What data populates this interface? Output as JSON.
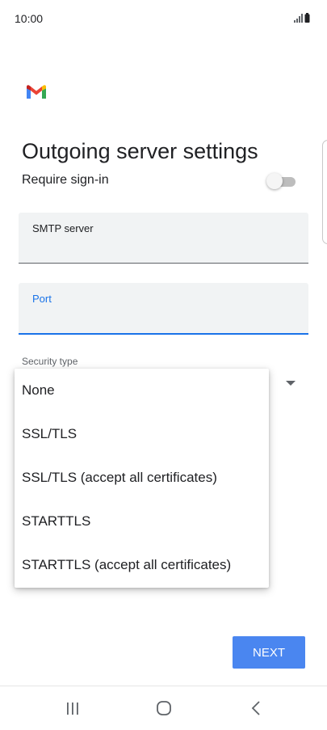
{
  "status_bar": {
    "time": "10:00",
    "icons": [
      "signal-icon",
      "battery-icon"
    ]
  },
  "app": {
    "logo": "gmail-logo"
  },
  "page": {
    "title": "Outgoing server settings"
  },
  "require_signin": {
    "label": "Require sign-in",
    "enabled": false
  },
  "smtp_server": {
    "label": "SMTP server",
    "value": ""
  },
  "port": {
    "label": "Port",
    "value": "",
    "focused": true
  },
  "security": {
    "label": "Security type",
    "options": [
      "None",
      "SSL/TLS",
      "SSL/TLS (accept all certificates)",
      "STARTTLS",
      "STARTTLS (accept all certificates)"
    ]
  },
  "actions": {
    "next_label": "NEXT"
  },
  "nav": {
    "buttons": [
      "recent-apps-icon",
      "home-icon",
      "back-icon"
    ]
  },
  "colors": {
    "accent": "#1a73e8",
    "button": "#4a86f0",
    "field_bg": "#f1f3f4"
  }
}
